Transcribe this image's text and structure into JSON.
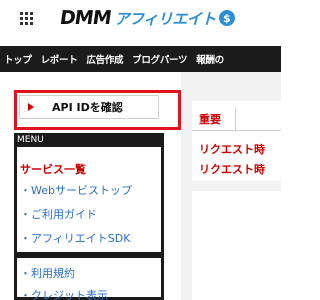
{
  "header": {
    "logo_main": "DMM",
    "logo_sub": "アフィリエイト",
    "logo_mark": "$"
  },
  "nav": {
    "items": [
      "トップ",
      "レポート",
      "広告作成",
      "ブログパーツ",
      "報酬の"
    ]
  },
  "sidebar": {
    "api_button_label": "API IDを確認",
    "menu_header": "MENU",
    "menu_title": "サービス一覧",
    "links": [
      "・Webサービストップ",
      "・ご利用ガイド",
      "・アフィリエイトSDK"
    ],
    "links2": [
      "・利用規約",
      "・クレジット表示"
    ]
  },
  "notice": {
    "tab_label": "重要",
    "items": [
      "リクエスト時",
      "リクエスト時"
    ]
  },
  "colors": {
    "accent_red": "#cc0000",
    "highlight_red": "#e0141e",
    "link_blue": "#2a6ec9",
    "brand_blue": "#2a8fd6",
    "dark": "#1b1b1b"
  }
}
